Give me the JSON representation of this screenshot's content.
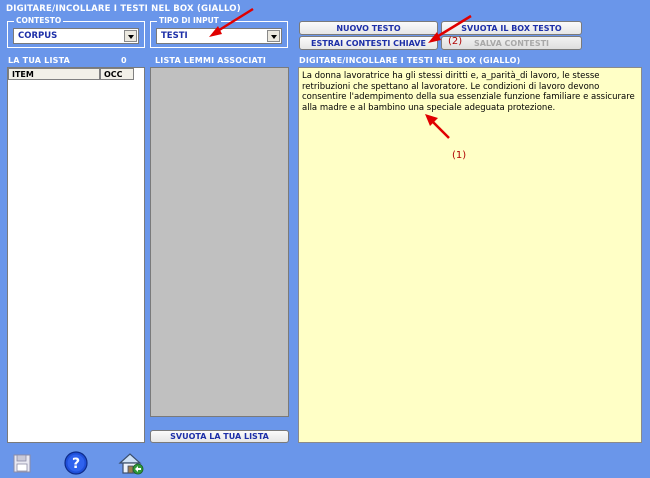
{
  "header": {
    "title": "DIGITARE/INCOLLARE I TESTI NEL BOX (GIALLO)"
  },
  "contesto": {
    "legend": "CONTESTO",
    "value": "CORPUS"
  },
  "tipo_input": {
    "legend": "TIPO DI INPUT",
    "value": "TESTI"
  },
  "buttons": {
    "nuovo_testo": "NUOVO TESTO",
    "svuota_box": "SVUOTA IL BOX TESTO",
    "estrai_contesti": "ESTRAI CONTESTI CHIAVE",
    "salva_contesti": "SALVA CONTESTI",
    "svuota_lista": "SVUOTA LA TUA LISTA"
  },
  "tua_lista": {
    "label": "LA TUA LISTA",
    "count": "0",
    "col_item": "ITEM",
    "col_occ": "OCC"
  },
  "lemmi": {
    "label": "LISTA LEMMI ASSOCIATI"
  },
  "text_box": {
    "label": "DIGITARE/INCOLLARE I TESTI NEL BOX (GIALLO)",
    "content": "La donna lavoratrice ha gli stessi diritti e, a_parità_di lavoro, le stesse retribuzioni che spettano al lavoratore. Le condizioni di lavoro devono consentire l'adempimento della sua essenziale funzione familiare e assicurare alla madre e al bambino una speciale adeguata protezione."
  },
  "annotations": {
    "note1": "(1)",
    "note2": "(2)"
  },
  "icons": [
    "save-icon",
    "help-icon",
    "home-icon"
  ],
  "colors": {
    "background": "#6a96ea",
    "text_box": "#ffffc6",
    "arrow": "#e00000",
    "combo_text": "#1d2fa8"
  }
}
